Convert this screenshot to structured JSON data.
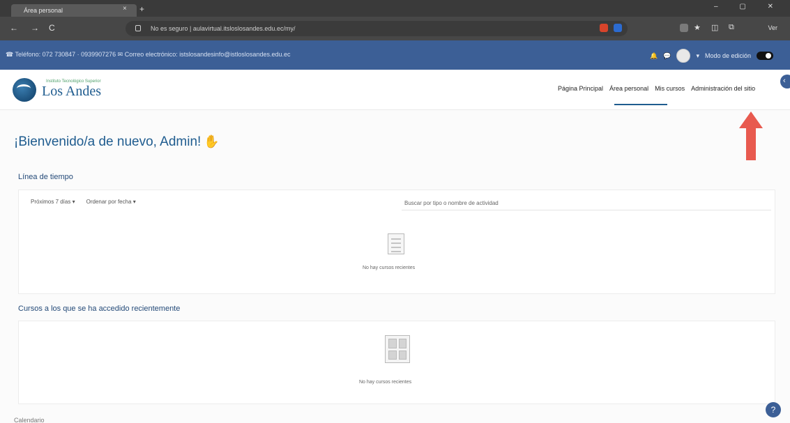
{
  "browser": {
    "tab_title": "Área personal",
    "tab_close": "×",
    "tab_new": "+",
    "window_controls": "– ▢ ✕",
    "url": "No es seguro  |  aulavirtual.itsloslosandes.edu.ec/my/",
    "reading_mode": "Ver",
    "nav": {
      "back": "←",
      "forward": "→",
      "reload": "C"
    },
    "ext_colors": [
      "#d8442b",
      "#2c6bd0",
      "#7a7a7a"
    ]
  },
  "infobar": {
    "contact": "☎ Teléfono: 072 730847 · 0939907276  ✉ Correo electrónico: istslosandesinfo@istloslosandes.edu.ec",
    "bell": "🔔",
    "chat": "💬",
    "user_caret": "▾",
    "edit_mode_label": "Modo de edición"
  },
  "header": {
    "logo_tagline": "Instituto Tecnológico Superior",
    "logo_name": "Los Andes",
    "nav": [
      {
        "label": "Página Principal"
      },
      {
        "label": "Área personal"
      },
      {
        "label": "Mis cursos"
      },
      {
        "label": "Administración del sitio"
      }
    ],
    "drawer": "‹"
  },
  "main": {
    "welcome": "¡Bienvenido/a de nuevo, Admin!",
    "wave_icon": "✋",
    "timeline": {
      "title": "Línea de tiempo",
      "filter_days": "Próximos 7 días ▾",
      "filter_sort": "Ordenar por fecha ▾",
      "search_placeholder": "Buscar por tipo o nombre de actividad",
      "empty_text": "No hay cursos recientes"
    },
    "recent": {
      "title": "Cursos a los que se ha accedido recientemente",
      "empty_text": "No hay cursos recientes"
    },
    "bottom_partial": "Calendario"
  },
  "help": "?",
  "colors": {
    "brand": "#3c5f96",
    "accent": "#1f5c8f",
    "arrow": "#e85a4f"
  }
}
